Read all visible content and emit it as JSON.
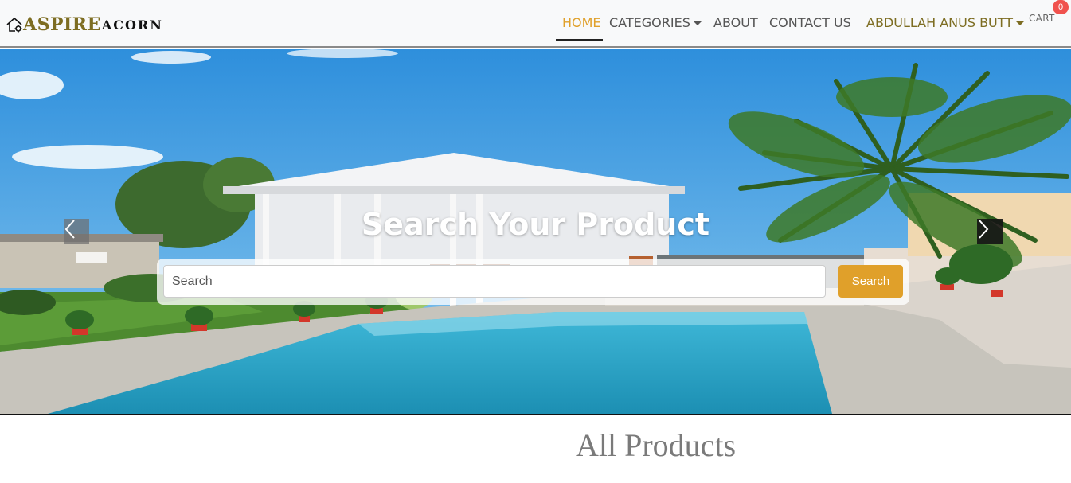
{
  "brand": {
    "part1": "ASPIRE",
    "part2": "ACORN",
    "icon": "house-gear-icon"
  },
  "nav": {
    "home": "HOME",
    "categories": "CATEGORIES",
    "about": "ABOUT",
    "contact": "CONTACT US",
    "user": "ABDULLAH ANUS BUTT",
    "cart": "CART",
    "cart_count": "0"
  },
  "hero": {
    "title": "Search Your Product",
    "search_placeholder": "Search",
    "search_button": "Search",
    "prev_icon": "chevron-left-icon",
    "next_icon": "chevron-right-icon"
  },
  "section": {
    "title": "All Products"
  },
  "colors": {
    "accent": "#e0a02a",
    "brand": "#7d6d22",
    "badge": "#f0524e"
  }
}
